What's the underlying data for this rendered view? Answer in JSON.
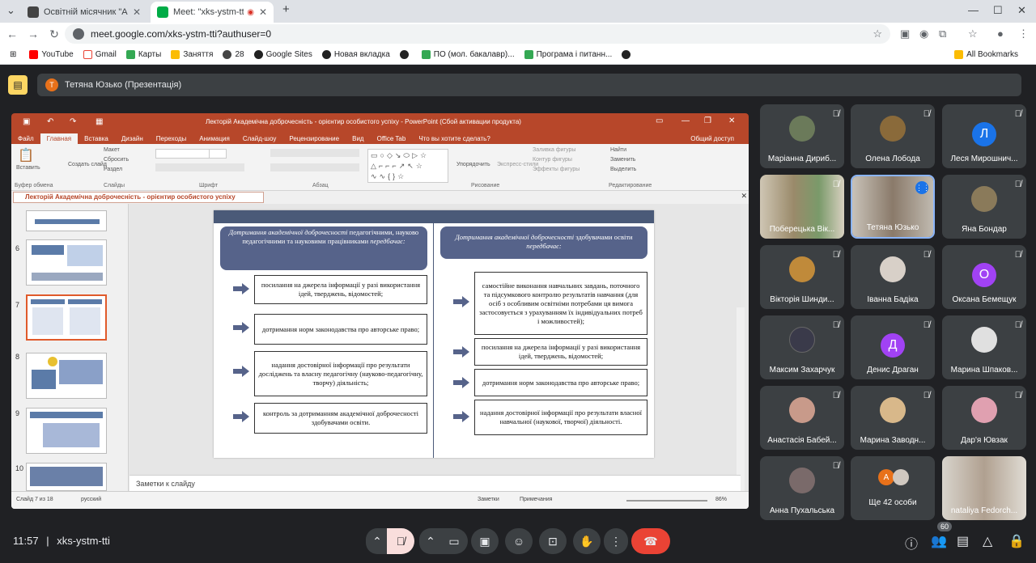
{
  "browser": {
    "tabs": [
      {
        "title": "Освітній місячник \"Академічн",
        "active": false
      },
      {
        "title": "Meet: \"xks-ystm-tti\"",
        "active": true
      }
    ],
    "new_tab": "+",
    "url": "meet.google.com/xks-ystm-tti?authuser=0",
    "bookmarks": [
      "YouTube",
      "Gmail",
      "Карты",
      "Заняття",
      "28",
      "Google Sites",
      "Новая вкладка",
      "",
      "ПО (мол. бакалавр)...",
      "Програма і питанн...",
      ""
    ],
    "all_bookmarks": "All Bookmarks"
  },
  "meet": {
    "presenter_label": "Тетяна Юзько (Презентація)",
    "presenter_initial": "Т",
    "time": "11:57",
    "meeting_code": "xks-ystm-tti",
    "participants_count": "60"
  },
  "ppt": {
    "title": "Лекторій Академічна доброчесність - орієнтир особистого успіху - PowerPoint (Сбой активации продукта)",
    "tabs": [
      "Файл",
      "Главная",
      "Вставка",
      "Дизайн",
      "Переходы",
      "Анимация",
      "Слайд-шоу",
      "Рецензирование",
      "Вид",
      "Office Tab",
      "Что вы хотите сделать?"
    ],
    "shared_access": "Общий доступ",
    "ribbon": {
      "paste": "Вставить",
      "clipboard": "Буфер обмена",
      "create_slide": "Создать слайд",
      "layout": "Макет",
      "reset": "Сбросить",
      "section": "Раздел",
      "slides": "Слайды",
      "font": "Шрифт",
      "paragraph": "Абзац",
      "arrange": "Упорядочить",
      "express_styles": "Экспресс-стили",
      "fill": "Заливка фигуры",
      "outline": "Контур фигуры",
      "effects": "Эффекты фигуры",
      "drawing": "Рисование",
      "find": "Найти",
      "replace": "Заменить",
      "select": "Выделить",
      "editing": "Редактирование"
    },
    "doc_tab": "Лекторій Академічна доброчесність - орієнтир особистого успіху",
    "thumb_numbers": [
      "6",
      "7",
      "8",
      "9",
      "10"
    ],
    "notes_placeholder": "Заметки к слайду",
    "status": {
      "slide": "Слайд 7 из 18",
      "lang": "русский",
      "notes": "Заметки",
      "comments": "Примечания",
      "zoom": "86%"
    },
    "slide": {
      "left_header_italic": "Дотримання академічної доброчесності",
      "left_header_rest": "педагогічними, науково педагогічними та науковими працівниками",
      "left_header_end": "передбачає:",
      "right_header_italic": "Дотримання академічної доброчесності",
      "right_header_rest": "здобувачами освіти",
      "right_header_end": "передбачає:",
      "left_items": [
        "посилання на джерела інформації у разі використання ідей, тверджень, відомостей;",
        "дотримання норм законодавства про авторське право;",
        "надання достовірної інформації про результати досліджень та власну педагогічну (науково-педагогічну, творчу) діяльність;",
        "контроль за дотриманням академічної доброчесності здобувачами освіти."
      ],
      "right_items": [
        "самостійне виконання навчальних завдань, поточного та підсумкового контролю результатів навчання (для осіб з особливим освітніми потребами ця вимога застосовується з урахуванням їх індивідуальних потреб і можливостей);",
        "посилання на джерела інформації у разі використання ідей, тверджень, відомостей;",
        "дотримання норм законодавства про авторське право;",
        "надання достовірної інформації про результати власної навчальної (наукової, творчої) діяльності."
      ]
    }
  },
  "participants": [
    {
      "name": "Маріанна Дириб...",
      "type": "photo",
      "color": "#6b7a5a"
    },
    {
      "name": "Олена Лобода",
      "type": "photo",
      "color": "#8a6a3a"
    },
    {
      "name": "Леся Мирошнич...",
      "type": "initial",
      "initial": "Л",
      "color": "#1a73e8"
    },
    {
      "name": "Поберецька Вік...",
      "type": "video",
      "color": "#9a8a6a"
    },
    {
      "name": "Тетяна Юзько",
      "type": "video",
      "color": "#b0a89a"
    },
    {
      "name": "Яна Бондар",
      "type": "photo",
      "color": "#8a7a5a"
    },
    {
      "name": "Вікторія Шинди...",
      "type": "photo",
      "color": "#c08a3a"
    },
    {
      "name": "Іванна Бадіка",
      "type": "photo",
      "color": "#d8d0c8"
    },
    {
      "name": "Оксана Бемещук",
      "type": "initial",
      "initial": "О",
      "color": "#a142f4"
    },
    {
      "name": "Максим Захарчук",
      "type": "photo",
      "color": "#3a3a4a"
    },
    {
      "name": "Денис Драган",
      "type": "initial",
      "initial": "Д",
      "color": "#a142f4"
    },
    {
      "name": "Марина Шпаков...",
      "type": "photo",
      "color": "#e0e0e0"
    },
    {
      "name": "Анастасія Бабей...",
      "type": "photo",
      "color": "#c89a8a"
    },
    {
      "name": "Марина Заводн...",
      "type": "photo",
      "color": "#d8b88a"
    },
    {
      "name": "Дар'я Ювзак",
      "type": "photo",
      "color": "#e0a0b0"
    },
    {
      "name": "Анна Пухальська",
      "type": "photo",
      "color": "#7a6a6a"
    },
    {
      "name": "Ще 42 особи",
      "type": "more",
      "initial": "А",
      "color": "#e8711a"
    },
    {
      "name": "nataliya Fedorch...",
      "type": "video",
      "color": "#c0b8b0"
    }
  ]
}
